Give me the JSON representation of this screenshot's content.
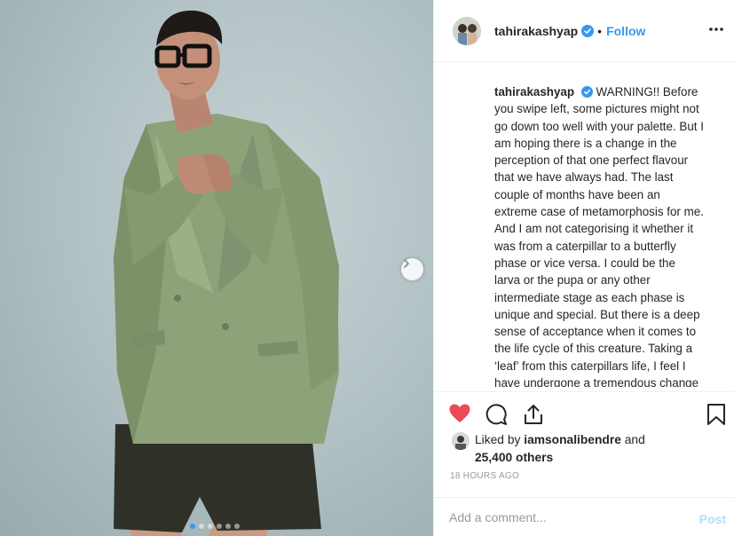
{
  "post": {
    "username": "tahirakashyap",
    "separator": "•",
    "follow_label": "Follow",
    "caption_text": "WARNING!! Before you swipe left, some pictures might not go down too well with your palette. But I am hoping there is a change in the perception of that one perfect flavour that we have always had. The last couple of months have been an extreme case of metamorphosis for me. And I am not categorising it whether it was from a caterpillar to a butterfly phase or vice versa. I could be the larva or the pupa or any other intermediate stage as each phase is unique and special. But there is a deep sense of acceptance when it comes to the life cycle of this creature. Taking a ‘leaf’ from this caterpillars life, I feel I have undergone a tremendous change",
    "likes": {
      "prefix": "Liked by",
      "user": "iamsonalibendre",
      "and": "and",
      "others": "25,400 others"
    },
    "timestamp": "18 HOURS AGO",
    "comment_placeholder": "Add a comment...",
    "post_label": "Post",
    "carousel": {
      "count": 6,
      "active_index": 0
    }
  },
  "colors": {
    "accent": "#3897f0",
    "liked_heart": "#ed4956",
    "muted": "#999999",
    "post_disabled": "#b2dffc",
    "divider": "#efefef"
  },
  "icons": {
    "header": [
      "avatar",
      "verified-badge-icon",
      "more-options-icon"
    ],
    "actions": [
      "heart-icon",
      "comment-icon",
      "share-icon",
      "bookmark-icon"
    ],
    "carousel": [
      "chevron-right-icon"
    ]
  }
}
